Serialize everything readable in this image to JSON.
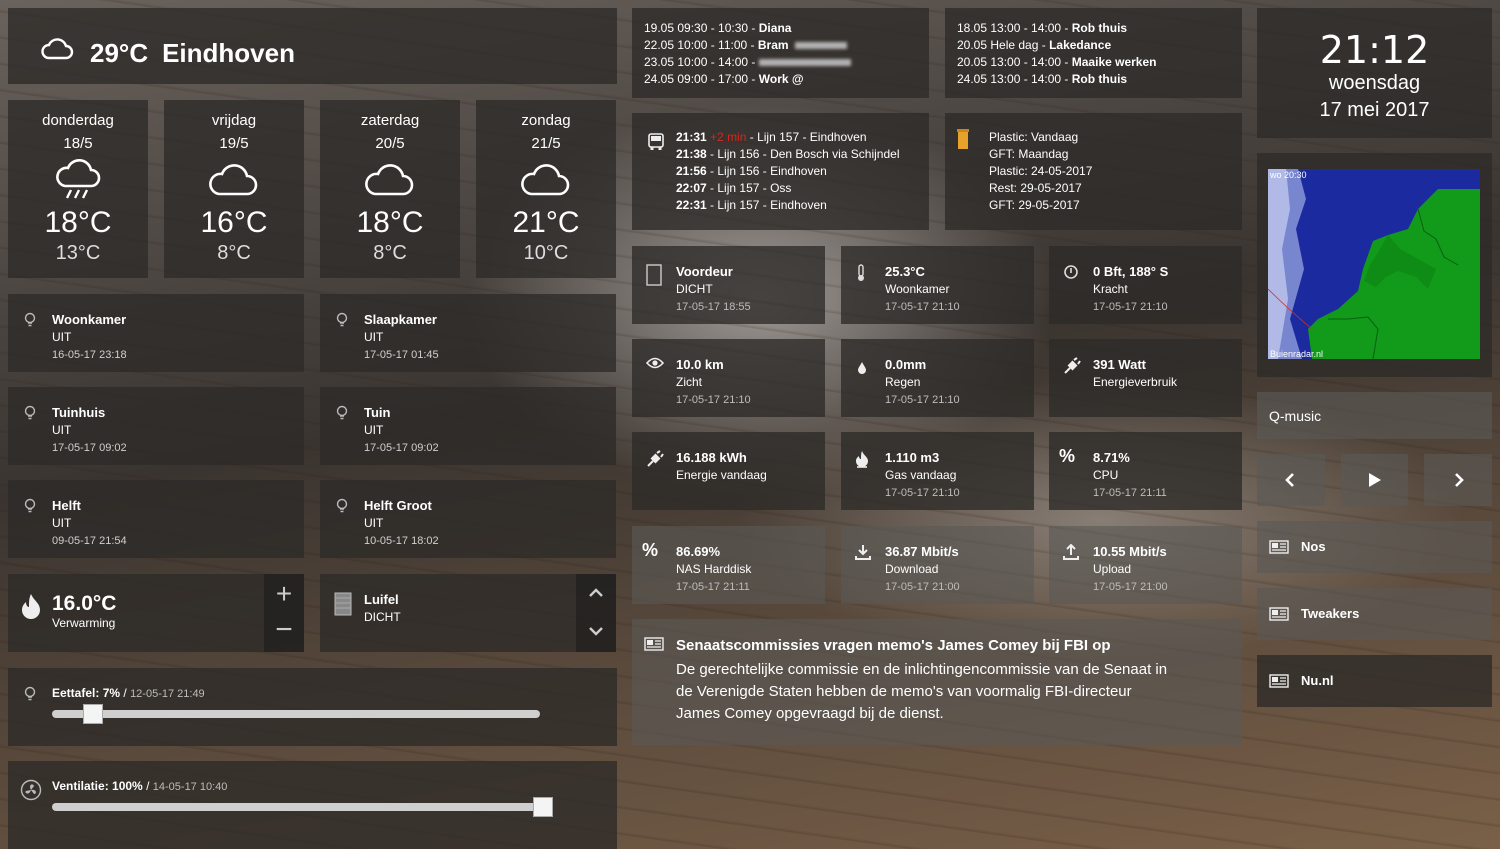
{
  "weather": {
    "current_temp": "29°C",
    "city": "Eindhoven",
    "forecast": [
      {
        "day": "donderdag",
        "date": "18/5",
        "hi": "18°C",
        "lo": "13°C",
        "icon": "rain-cloud-icon"
      },
      {
        "day": "vrijdag",
        "date": "19/5",
        "hi": "16°C",
        "lo": "8°C",
        "icon": "cloud-icon"
      },
      {
        "day": "zaterdag",
        "date": "20/5",
        "hi": "18°C",
        "lo": "8°C",
        "icon": "cloud-icon"
      },
      {
        "day": "zondag",
        "date": "21/5",
        "hi": "21°C",
        "lo": "10°C",
        "icon": "cloud-icon"
      }
    ]
  },
  "lights": [
    {
      "name": "Woonkamer",
      "state": "UIT",
      "ts": "16-05-17 23:18"
    },
    {
      "name": "Slaapkamer",
      "state": "UIT",
      "ts": "17-05-17 01:45"
    },
    {
      "name": "Tuinhuis",
      "state": "UIT",
      "ts": "17-05-17 09:02"
    },
    {
      "name": "Tuin",
      "state": "UIT",
      "ts": "17-05-17 09:02"
    },
    {
      "name": "Helft",
      "state": "UIT",
      "ts": "09-05-17 21:54"
    },
    {
      "name": "Helft Groot",
      "state": "UIT",
      "ts": "10-05-17 18:02"
    }
  ],
  "heating": {
    "temp": "16.0°C",
    "label": "Verwarming"
  },
  "awning": {
    "name": "Luifel",
    "state": "DICHT"
  },
  "dimmers": [
    {
      "name": "Eettafel:",
      "value": "7%",
      "sep": "/",
      "ts": "12-05-17 21:49",
      "level": 0.07
    },
    {
      "name": "Ventilatie:",
      "value": "100%",
      "sep": "/",
      "ts": "14-05-17 10:40",
      "level": 1.0
    }
  ],
  "calendar_left": [
    {
      "when": "19.05 09:30 - 10:30 -",
      "what": "Diana"
    },
    {
      "when": "22.05 10:00 - 11:00 -",
      "what": "Bram"
    },
    {
      "when": "23.05 10:00 - 14:00 -",
      "what": ""
    },
    {
      "when": "24.05 09:00 - 17:00 -",
      "what": "Work @"
    }
  ],
  "calendar_right": [
    {
      "when": "18.05 13:00 - 14:00 -",
      "what": "Rob thuis"
    },
    {
      "when": "20.05 Hele dag -",
      "what": "Lakedance"
    },
    {
      "when": "20.05 13:00 - 14:00 -",
      "what": "Maaike werken"
    },
    {
      "when": "24.05 13:00 - 14:00 -",
      "what": "Rob thuis"
    }
  ],
  "bus": [
    {
      "time": "21:31",
      "delay": "+2 min",
      "line": "- Lijn 157 - Eindhoven"
    },
    {
      "time": "21:38",
      "delay": "",
      "line": "- Lijn 156 - Den Bosch via Schijndel"
    },
    {
      "time": "21:56",
      "delay": "",
      "line": "- Lijn 156 - Eindhoven"
    },
    {
      "time": "22:07",
      "delay": "",
      "line": "- Lijn 157 - Oss"
    },
    {
      "time": "22:31",
      "delay": "",
      "line": "- Lijn 157 - Eindhoven"
    }
  ],
  "garbage": [
    "Plastic: Vandaag",
    "GFT: Maandag",
    "Plastic: 24-05-2017",
    "Rest: 29-05-2017",
    "GFT: 29-05-2017"
  ],
  "sensors": [
    {
      "name": "Voordeur",
      "state": "DICHT",
      "ts": "17-05-17 18:55",
      "icon": "door-icon"
    },
    {
      "name": "25.3°C",
      "state": "Woonkamer",
      "ts": "17-05-17 21:10",
      "icon": "thermometer-icon"
    },
    {
      "name": "0 Bft, 188° S",
      "state": "Kracht",
      "ts": "17-05-17 21:10",
      "icon": "wind-icon"
    },
    {
      "name": "10.0 km",
      "state": "Zicht",
      "ts": "17-05-17 21:10",
      "icon": "eye-icon"
    },
    {
      "name": "0.0mm",
      "state": "Regen",
      "ts": "17-05-17 21:10",
      "icon": "drop-icon"
    },
    {
      "name": "391 Watt",
      "state": "Energieverbruik",
      "ts": "",
      "icon": "plug-icon"
    },
    {
      "name": "16.188 kWh",
      "state": "Energie vandaag",
      "ts": "",
      "icon": "plug-icon"
    },
    {
      "name": "1.110 m3",
      "state": "Gas vandaag",
      "ts": "17-05-17 21:10",
      "icon": "flame-icon"
    },
    {
      "name": "8.71%",
      "state": "CPU",
      "ts": "17-05-17 21:11",
      "icon": "percent-icon"
    },
    {
      "name": "86.69%",
      "state": "NAS Harddisk",
      "ts": "17-05-17 21:11",
      "icon": "percent-icon"
    },
    {
      "name": "36.87 Mbit/s",
      "state": "Download",
      "ts": "17-05-17 21:00",
      "icon": "download-icon"
    },
    {
      "name": "10.55 Mbit/s",
      "state": "Upload",
      "ts": "17-05-17 21:00",
      "icon": "upload-icon"
    }
  ],
  "news": {
    "title": "Senaatscommissies vragen memo's James Comey bij FBI op",
    "body": "De gerechtelijke commissie en de inlichtingencommissie van de Senaat in de Verenigde Staten hebben de memo's van voormalig FBI-directeur James Comey opgevraagd bij de dienst."
  },
  "clock": {
    "time": "21:12",
    "weekday": "woensdag",
    "date": "17 mei 2017"
  },
  "radar": {
    "timestamp": "wo 20:30",
    "credit": "Buienradar.nl"
  },
  "radio": {
    "station": "Q-music"
  },
  "feeds": [
    "Nos",
    "Tweakers",
    "Nu.nl"
  ]
}
